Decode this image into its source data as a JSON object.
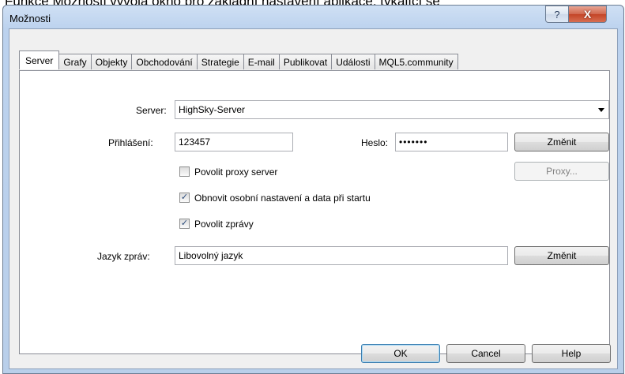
{
  "caption": "Funkce Možnosti vyvolá okno pro základní nastavení aplikace, týkající se",
  "window": {
    "title": "Možnosti",
    "help_glyph": "?",
    "close_glyph": "X"
  },
  "tabs": [
    "Server",
    "Grafy",
    "Objekty",
    "Obchodování",
    "Strategie",
    "E-mail",
    "Publikovat",
    "Události",
    "MQL5.community"
  ],
  "active_tab": "Server",
  "server": {
    "label": "Server:",
    "value": "HighSky-Server"
  },
  "login": {
    "label": "Přihlášení:",
    "value": "123457"
  },
  "password": {
    "label": "Heslo:",
    "value": "•••••••"
  },
  "change_password_button": "Změnit",
  "proxy_checkbox": {
    "label": "Povolit proxy server",
    "checked": false
  },
  "proxy_button": "Proxy...",
  "restore_checkbox": {
    "label": "Obnovit osobní nastavení a data při startu",
    "checked": true
  },
  "news_checkbox": {
    "label": "Povolit zprávy",
    "checked": true
  },
  "news_language": {
    "label": "Jazyk zpráv:",
    "value": "Libovolný jazyk"
  },
  "change_language_button": "Změnit",
  "footer": {
    "ok": "OK",
    "cancel": "Cancel",
    "help": "Help"
  },
  "checkmark_glyph": "✓"
}
